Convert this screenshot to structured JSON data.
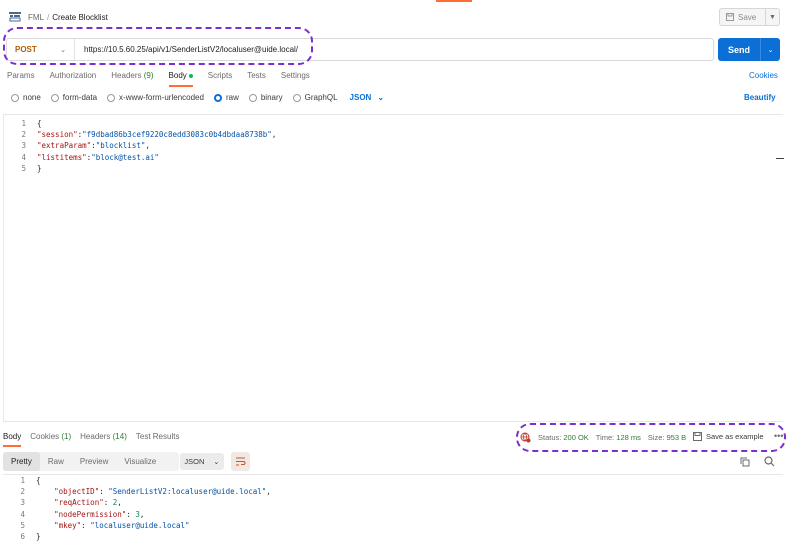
{
  "breadcrumb": {
    "collection": "FML",
    "separator": "/",
    "request": "Create Blocklist"
  },
  "toolbar": {
    "save_label": "Save"
  },
  "request": {
    "method": "POST",
    "url": "https://10.5.60.25/api/v1/SenderListV2/localuser@uide.local/",
    "send_label": "Send"
  },
  "request_tabs": [
    {
      "label": "Params"
    },
    {
      "label": "Authorization"
    },
    {
      "label": "Headers",
      "count": "(9)"
    },
    {
      "label": "Body"
    },
    {
      "label": "Scripts"
    },
    {
      "label": "Tests"
    },
    {
      "label": "Settings"
    }
  ],
  "cookies_label": "Cookies",
  "body_types": [
    "none",
    "form-data",
    "x-www-form-urlencoded",
    "raw",
    "binary",
    "GraphQL"
  ],
  "body_type_selected": "raw",
  "body_format": "JSON",
  "beautify_label": "Beautify",
  "request_body": {
    "line_numbers": [
      "1",
      "2",
      "3",
      "4",
      "5"
    ],
    "l1": "{",
    "l2_key": "\"session\"",
    "l2_val": "\"f9dbad86b3cef9220c8edd3083c0b4dbdaa8738b\"",
    "l3_key": "\"extraParam\"",
    "l3_val": "\"blocklist\"",
    "l4_key": "\"listitems\"",
    "l4_val": "\"block@test.ai\"",
    "l5": "}"
  },
  "response_tabs": [
    {
      "label": "Body"
    },
    {
      "label": "Cookies",
      "count": "(1)"
    },
    {
      "label": "Headers",
      "count": "(14)"
    },
    {
      "label": "Test Results"
    }
  ],
  "response_status": {
    "status_label": "Status:",
    "status_value": "200 OK",
    "time_label": "Time:",
    "time_value": "128 ms",
    "size_label": "Size:",
    "size_value": "953 B"
  },
  "save_example_label": "Save as example",
  "response_formats": [
    "Pretty",
    "Raw",
    "Preview",
    "Visualize"
  ],
  "response_format_selected": "JSON",
  "response_body": {
    "line_numbers": [
      "1",
      "2",
      "3",
      "4",
      "5",
      "6"
    ],
    "l1": "{",
    "l2_key": "\"objectID\"",
    "l2_val": "\"SenderListV2:localuser@uide.local\"",
    "l3_key": "\"reqAction\"",
    "l3_val": "2",
    "l4_key": "\"nodePermission\"",
    "l4_val": "3",
    "l5_key": "\"mkey\"",
    "l5_val": "\"localuser@uide.local\"",
    "l6": "}"
  },
  "colors": {
    "accent": "#ff6c37",
    "send": "#0b6fd6",
    "annotation": "#7b2fd0",
    "status_ok": "#2e7d32"
  },
  "icons": [
    "collection-icon",
    "save-icon",
    "chevron-down-icon",
    "globe-error-icon",
    "more-icon",
    "wrap-lines-icon",
    "copy-icon",
    "search-icon"
  ]
}
